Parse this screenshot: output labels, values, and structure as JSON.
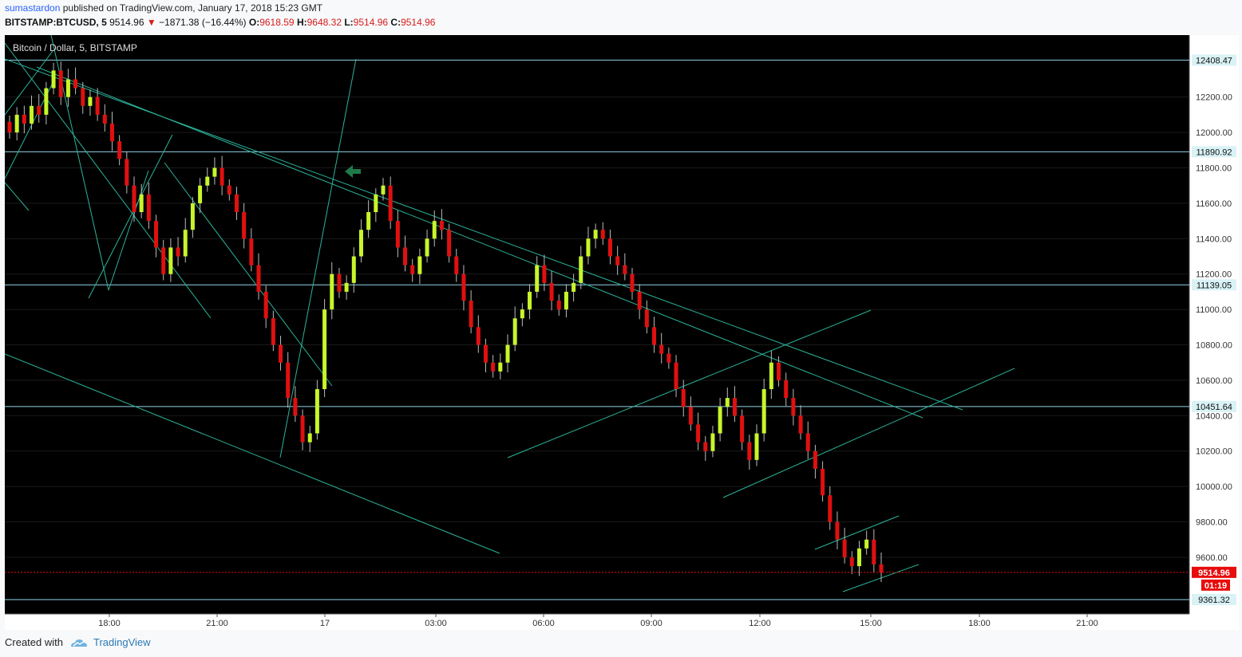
{
  "header": {
    "author": "sumastardon",
    "published_text": "published on TradingView.com, January 17, 2018 15:23 GMT",
    "symbol": "BITSTAMP:BTCUSD, 5",
    "last": "9514.96",
    "change": "−1871.38 (−16.44%)",
    "o_label": "O:",
    "o": "9618.59",
    "h_label": "H:",
    "h": "9648.32",
    "l_label": "L:",
    "l": "9514.96",
    "c_label": "C:",
    "c": "9514.96"
  },
  "footer": {
    "created_with": "Created with",
    "brand": "TradingView"
  },
  "colors": {
    "background": "#000000",
    "grid": "#1a1a1a",
    "bull": "#c8f52a",
    "bear": "#e01010",
    "trendline": "#2bb39a",
    "hline": "#8fd3e6",
    "price_tag_bg": "#d9f2f6",
    "current_tag_bg": "#e80c0c",
    "arrow": "#1f7a4a"
  },
  "icons": {
    "arrow": "left-arrow-icon",
    "logo": "tradingview-cloud-icon"
  },
  "chart_data": {
    "type": "candlestick",
    "title": "Bitcoin / Dollar, 5, BITSTAMP",
    "ylim": [
      9280,
      12550
    ],
    "y_ticks": [
      9600,
      9800,
      10000,
      10200,
      10400,
      10600,
      10800,
      11000,
      11200,
      11400,
      11600,
      11800,
      12000,
      12200
    ],
    "x_ticks": [
      "18:00",
      "21:00",
      "17",
      "03:00",
      "06:00",
      "09:00",
      "12:00",
      "15:00",
      "18:00",
      "21:00"
    ],
    "horizontal_levels": [
      12408.47,
      11890.92,
      11139.05,
      10451.64,
      9361.32
    ],
    "current_price": 9514.96,
    "countdown": "01:19",
    "series": [
      {
        "name": "BTCUSD",
        "closes": [
          12000,
          12100,
          12050,
          12150,
          12100,
          12250,
          12350,
          12200,
          12300,
          12250,
          12150,
          12200,
          12100,
          12050,
          11950,
          11850,
          11700,
          11550,
          11650,
          11500,
          11350,
          11200,
          11350,
          11300,
          11450,
          11600,
          11700,
          11750,
          11800,
          11700,
          11650,
          11550,
          11400,
          11250,
          11100,
          10950,
          10800,
          10700,
          10500,
          10400,
          10250,
          10300,
          10550,
          11000,
          11200,
          11100,
          11150,
          11300,
          11450,
          11550,
          11650,
          11700,
          11500,
          11350,
          11250,
          11200,
          11300,
          11400,
          11500,
          11450,
          11300,
          11200,
          11050,
          10900,
          10800,
          10700,
          10650,
          10700,
          10800,
          10950,
          11000,
          11100,
          11250,
          11150,
          11050,
          11000,
          11100,
          11150,
          11300,
          11400,
          11450,
          11400,
          11300,
          11250,
          11200,
          11100,
          11000,
          10900,
          10800,
          10750,
          10700,
          10550,
          10450,
          10350,
          10250,
          10200,
          10300,
          10450,
          10500,
          10400,
          10250,
          10150,
          10300,
          10550,
          10700,
          10600,
          10500,
          10400,
          10300,
          10200,
          10100,
          9950,
          9800,
          9700,
          9600,
          9550,
          9650,
          9700,
          9560,
          9514.96
        ]
      }
    ],
    "annotations": [
      "Bitcoin / Dollar, 5, BITSTAMP"
    ]
  }
}
